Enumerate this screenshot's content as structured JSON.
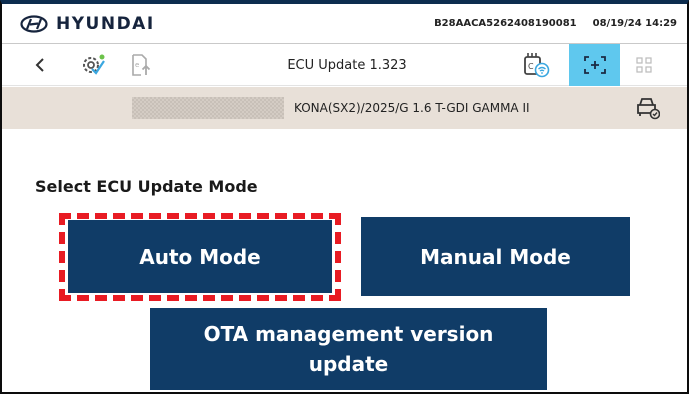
{
  "header": {
    "brand": "HYUNDAI",
    "vin": "B28AACA5262408190081",
    "datetime": "08/19/24 14:29"
  },
  "toolbar": {
    "back_icon": "chevron-left-icon",
    "title": "ECU Update 1.323",
    "icons": [
      "gear-check-icon",
      "file-upload-icon",
      "wifi-device-icon",
      "scan-plus-icon",
      "grid-icon"
    ],
    "active_color": "#5fc8ee"
  },
  "vehicle": {
    "description": "KONA(SX2)/2025/G 1.6 T-GDI GAMMA II",
    "icon": "car-settings-icon"
  },
  "content": {
    "section_title": "Select ECU Update Mode",
    "auto_mode_label": "Auto Mode",
    "manual_mode_label": "Manual Mode",
    "ota_label": "OTA management version update",
    "button_color": "#103c67",
    "highlight_color": "#e81b23"
  }
}
